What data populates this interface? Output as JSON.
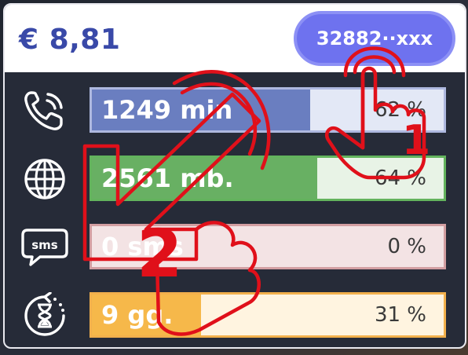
{
  "header": {
    "balance": "€ 8,81",
    "phone_number": "32882∙∙xxx"
  },
  "usage": [
    {
      "id": "minutes",
      "icon": "phone-icon",
      "amount": "1249 min",
      "percent_label": "62 %",
      "fraction": 0.62,
      "fill_color": "#6a7ec0",
      "track_color": "#e3e8f6",
      "border_color": "#aeb8df"
    },
    {
      "id": "data",
      "icon": "globe-icon",
      "amount": "2561 mb.",
      "percent_label": "64 %",
      "fraction": 0.64,
      "fill_color": "#68b063",
      "track_color": "#e8f3e6",
      "border_color": "#63b35d"
    },
    {
      "id": "sms",
      "icon": "sms-icon",
      "amount": "0 sms",
      "percent_label": "0 %",
      "fraction": 0.0,
      "fill_color": "#d99a9a",
      "track_color": "#f3e3e4",
      "border_color": "#d29ea1"
    },
    {
      "id": "days",
      "icon": "hourglass-renew-icon",
      "amount": "9 gg.",
      "percent_label": "31 %",
      "fraction": 0.31,
      "fill_color": "#f6b84a",
      "track_color": "#fff4e0",
      "border_color": "#f2b04c"
    }
  ],
  "gesture_annotations": [
    {
      "number": "1",
      "gesture": "tap"
    },
    {
      "number": "2",
      "gesture": "swipe-down-left"
    }
  ],
  "colors": {
    "accent": "#3949a8",
    "pill": "#6e72ef",
    "annotation": "#e0101a",
    "background": "#262b38"
  }
}
